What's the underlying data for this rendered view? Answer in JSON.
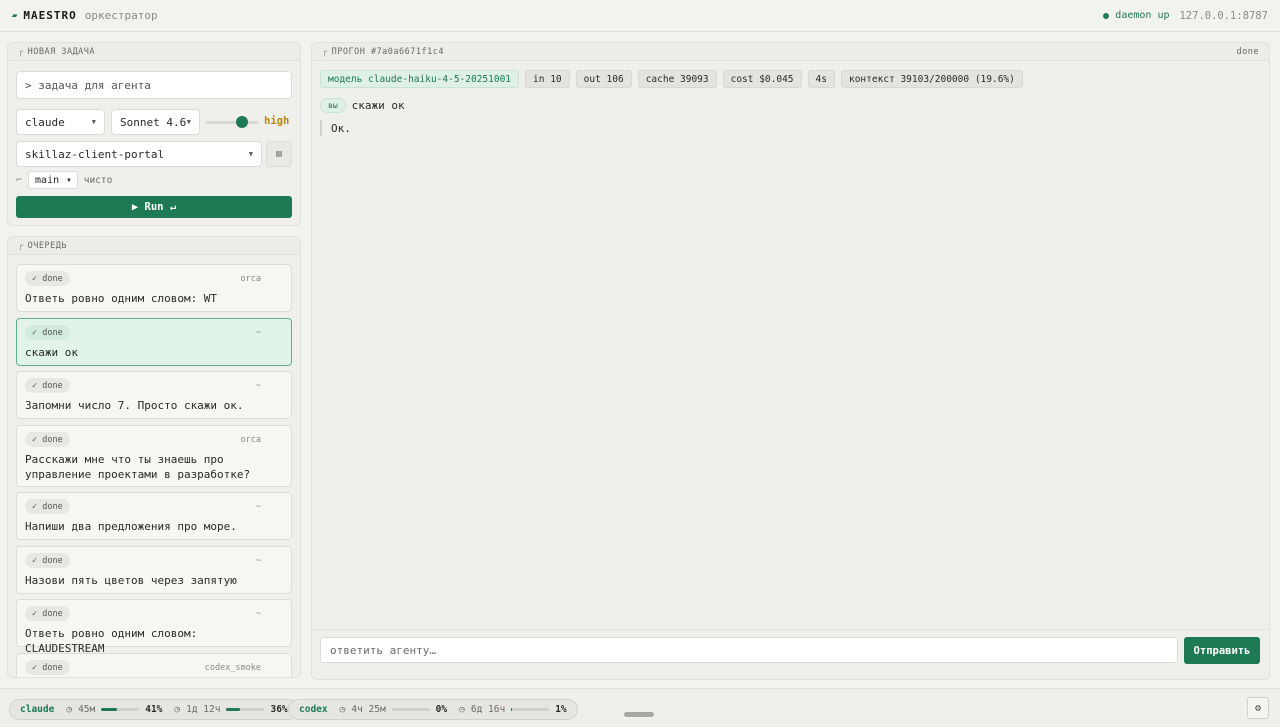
{
  "header": {
    "logo_icon": "wave-icon",
    "brand": "MAESTRO",
    "subtitle": "оркестратор",
    "daemon_status": "daemon up",
    "address": "127.0.0.1:8787"
  },
  "new_task": {
    "title": "НОВАЯ ЗАДАЧА",
    "prompt_text": "> задача для агента",
    "provider": "claude",
    "model": "Sonnet 4.6",
    "effort_level": 0.75,
    "effort_label": "high",
    "project": "skillaz-client-portal",
    "branch_icon": "git-branch-icon",
    "branch": "main",
    "branch_state": "чисто",
    "run_label": "▶ Run ↵"
  },
  "queue": {
    "title": "ОЧЕРЕДЬ",
    "items": [
      {
        "status": "✓ done",
        "source": "orca",
        "text": "Ответь ровно одним словом: WT",
        "active": false
      },
      {
        "status": "✓ done",
        "source": "~",
        "text": "скажи ок",
        "active": true
      },
      {
        "status": "✓ done",
        "source": "~",
        "text": "Запомни число 7. Просто скажи ок.",
        "active": false
      },
      {
        "status": "✓ done",
        "source": "orca",
        "text": "Расскажи мне что ты знаешь про управление проектами в разработке?",
        "active": false
      },
      {
        "status": "✓ done",
        "source": "~",
        "text": "Напиши два предложения про море.",
        "active": false
      },
      {
        "status": "✓ done",
        "source": "~",
        "text": "Назови пять цветов через запятую",
        "active": false
      },
      {
        "status": "✓ done",
        "source": "~",
        "text": "Ответь ровно одним словом: CLAUDESTREAM",
        "active": false
      },
      {
        "status": "✓ done",
        "source": "codex_smoke",
        "text": "",
        "active": false
      }
    ]
  },
  "run": {
    "title": "ПРОГОН #7a0a6671f1c4",
    "status": "done",
    "chips": {
      "model": "модель claude-haiku-4-5-20251001",
      "in": "in 10",
      "out": "out 106",
      "cache": "cache 39093",
      "cost": "cost $0.045",
      "time": "4s",
      "context": "контекст 39103/200000 (19.6%)"
    },
    "user_badge": "вы",
    "user_message": "скажи ок",
    "agent_reply": "Ок.",
    "reply_placeholder": "ответить агенту…",
    "send_label": "Отправить"
  },
  "footer": {
    "usage": [
      {
        "name": "claude",
        "w1_time": "45м",
        "w1_pct_value": 41,
        "w1_pct": "41%",
        "w2_time": "1д 12ч",
        "w2_pct_value": 36,
        "w2_pct": "36%"
      },
      {
        "name": "codex",
        "w1_time": "4ч 25м",
        "w1_pct_value": 0,
        "w1_pct": "0%",
        "w2_time": "6д 16ч",
        "w2_pct_value": 1,
        "w2_pct": "1%"
      }
    ],
    "clock_icon": "clock-icon",
    "settings_icon": "gear-icon"
  },
  "colors": {
    "accent": "#1e7a52",
    "effort": "#b8860b",
    "active_bg": "#e2f3e9"
  }
}
